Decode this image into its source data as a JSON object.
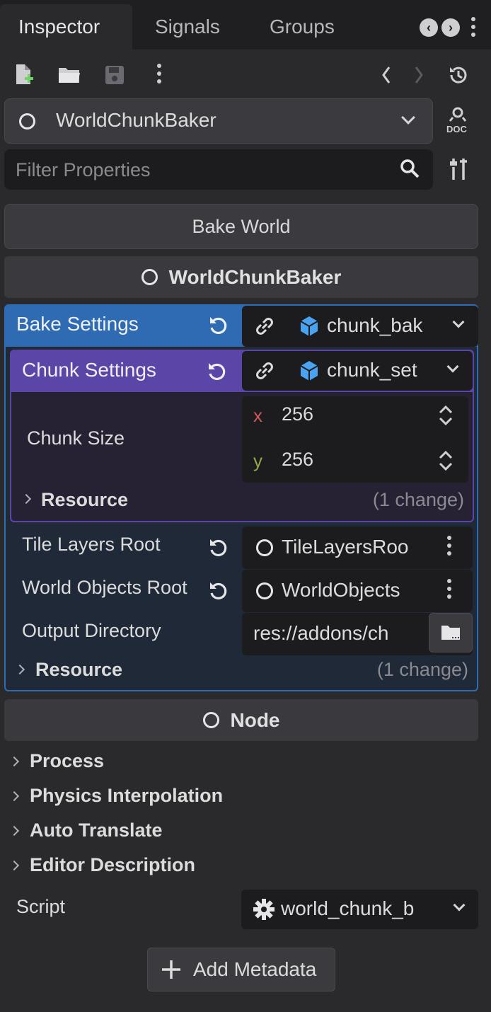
{
  "tabs": [
    "Inspector",
    "Signals",
    "Groups"
  ],
  "toolbar": {
    "icons": [
      "new-resource-icon",
      "open-folder-icon",
      "save-icon",
      "more-icon",
      "back-icon",
      "forward-icon",
      "history-icon"
    ]
  },
  "node_selector": {
    "value": "WorldChunkBaker"
  },
  "filter": {
    "placeholder": "Filter Properties"
  },
  "bake_button": "Bake World",
  "class_header": "WorldChunkBaker",
  "bake_settings": {
    "label": "Bake Settings",
    "resource": "chunk_bak",
    "accent": "#2f6bb3",
    "chunk_settings": {
      "label": "Chunk Settings",
      "resource": "chunk_set",
      "accent": "#5b46a8",
      "chunk_size": {
        "label": "Chunk Size",
        "x_label": "x",
        "x": "256",
        "y_label": "y",
        "y": "256"
      },
      "resource_group": {
        "label": "Resource",
        "changes": "(1 change)"
      }
    },
    "tile_layers_root": {
      "label": "Tile Layers Root",
      "value": "TileLayersRoo"
    },
    "world_objects_root": {
      "label": "World Objects Root",
      "value": "WorldObjects"
    },
    "output_directory": {
      "label": "Output Directory",
      "value": "res://addons/ch"
    },
    "resource_group": {
      "label": "Resource",
      "changes": "(1 change)"
    }
  },
  "node_header": "Node",
  "groups": [
    "Process",
    "Physics Interpolation",
    "Auto Translate",
    "Editor Description"
  ],
  "script": {
    "label": "Script",
    "value": "world_chunk_b"
  },
  "add_metadata": "Add Metadata"
}
